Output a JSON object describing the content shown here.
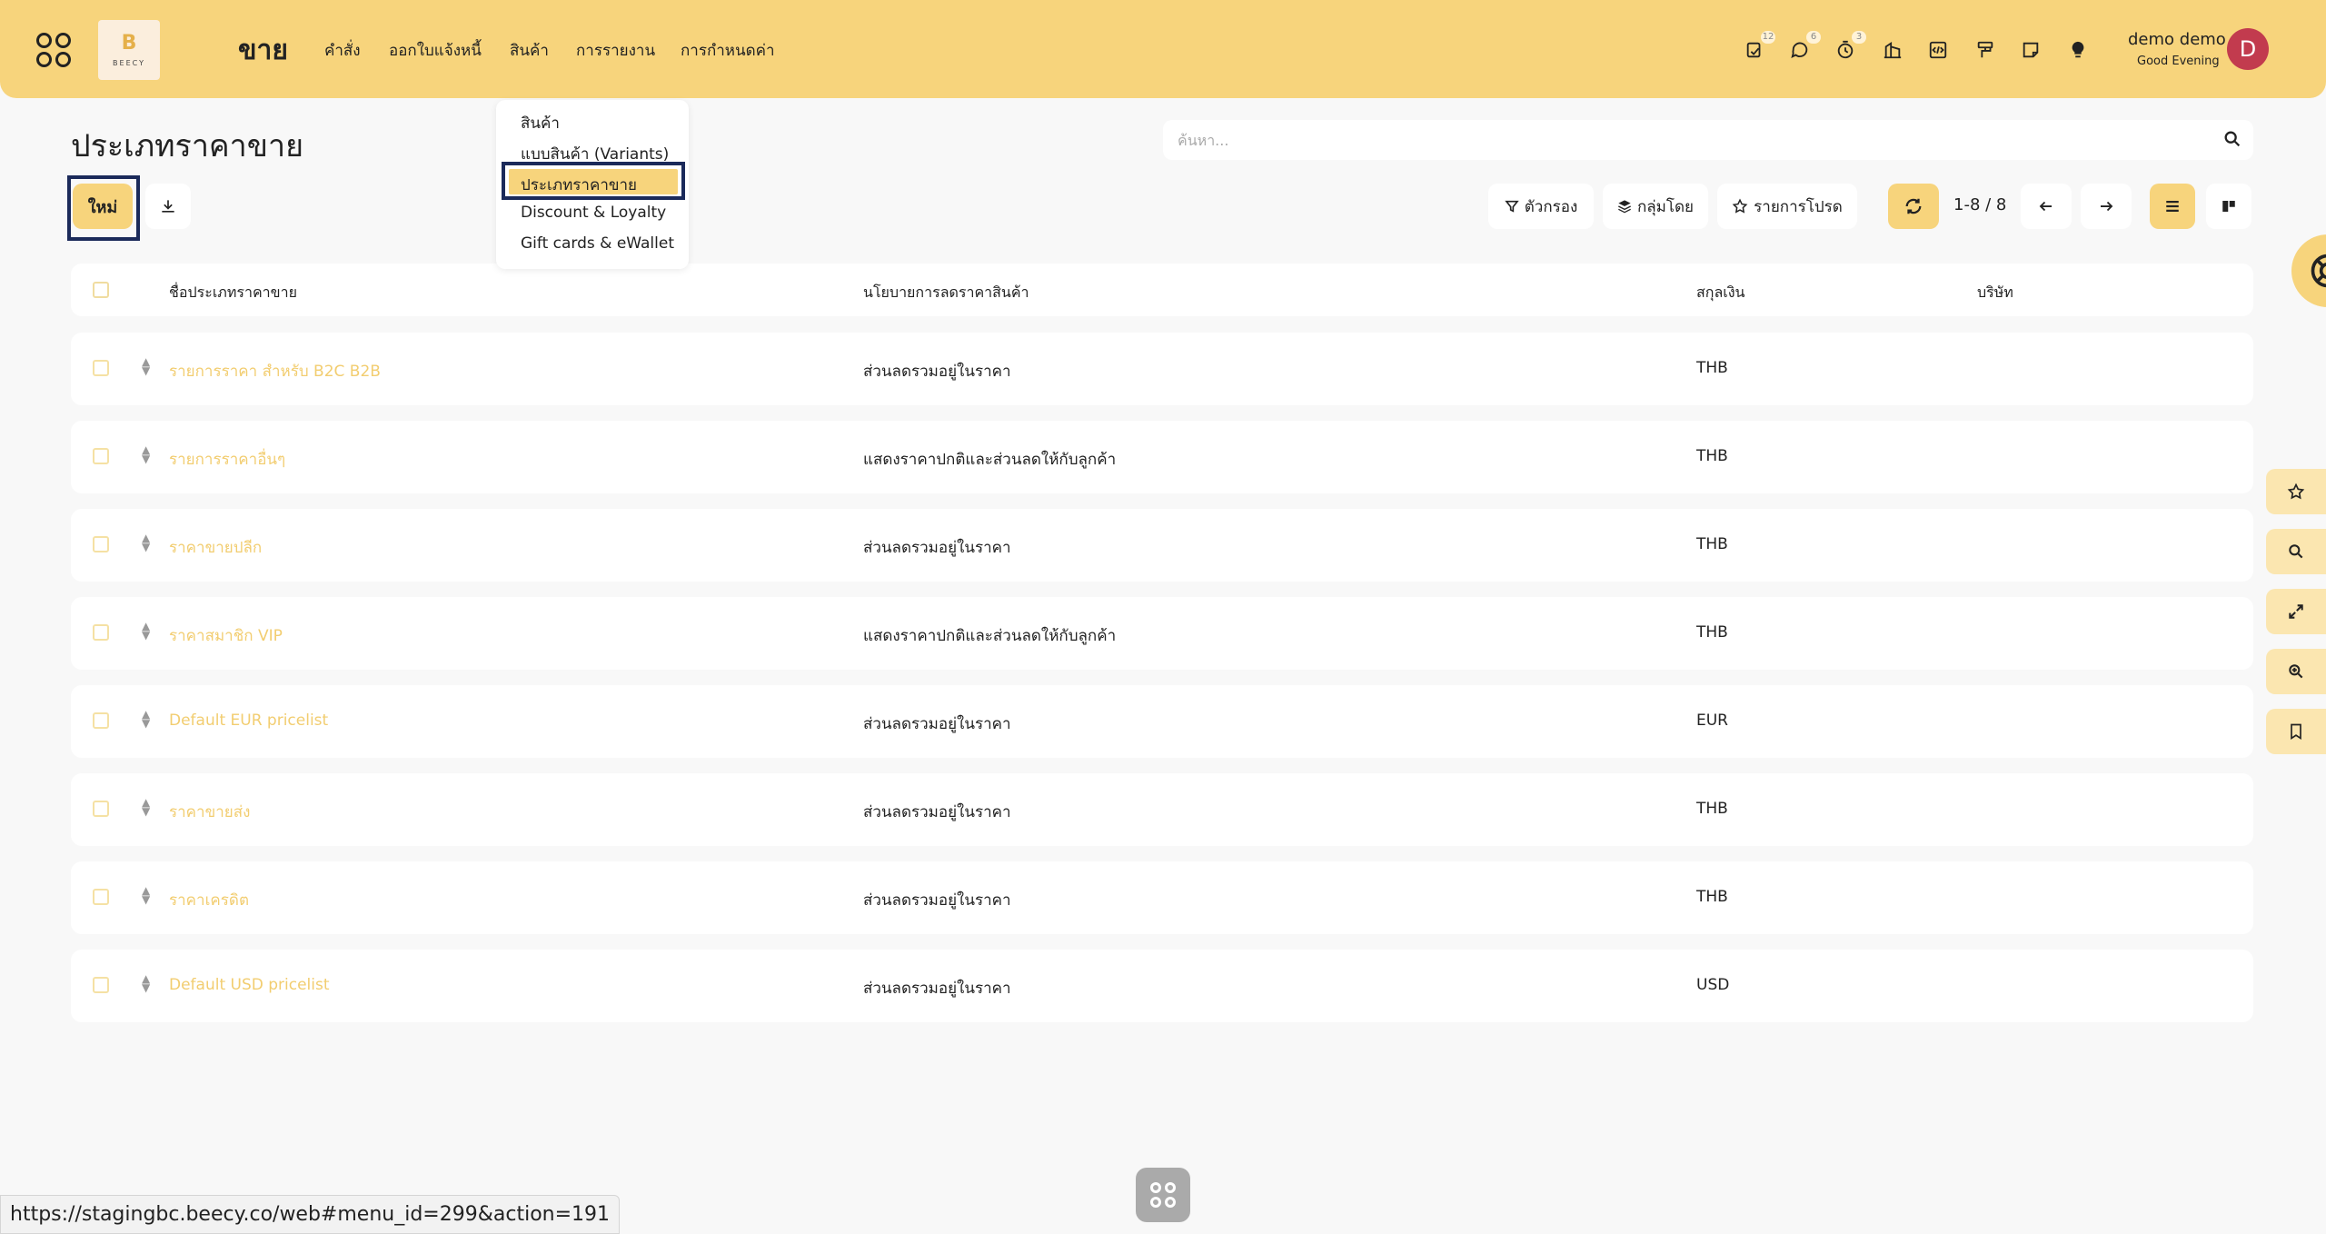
{
  "app": {
    "brand": "ขาย",
    "logo_letter": "B",
    "logo_text": "BEECY",
    "menu": [
      "คำสั่ง",
      "ออกใบแจ้งหนี้",
      "สินค้า",
      "การรายงาน",
      "การกำหนดค่า"
    ]
  },
  "systray": {
    "badges": [
      "12",
      "6",
      "3"
    ]
  },
  "user": {
    "name": "demo demo",
    "greeting": "Good Evening",
    "avatar_letter": "D",
    "avatar_color": "#c23b4e"
  },
  "page": {
    "title": "ประเภทราคาขาย"
  },
  "search": {
    "placeholder": "ค้นหา..."
  },
  "toolbar": {
    "new_label": "ใหม่",
    "filter_label": "ตัวกรอง",
    "group_label": "กลุ่มโดย",
    "favorites_label": "รายการโปรด",
    "pager": "1-8 / 8"
  },
  "dropdown": {
    "items": [
      "สินค้า",
      "แบบสินค้า (Variants)",
      "ประเภทราคาขาย",
      "Discount & Loyalty",
      "Gift cards & eWallet"
    ],
    "active_index": 2
  },
  "table": {
    "headers": {
      "name": "ชื่อประเภทราคาขาย",
      "policy": "นโยบายการลดราคาสินค้า",
      "currency": "สกุลเงิน",
      "company": "บริษัท"
    },
    "rows": [
      {
        "name": "รายการราคา สำหรับ B2C B2B",
        "policy": "ส่วนลดรวมอยู่ในราคา",
        "currency": "THB"
      },
      {
        "name": "รายการราคาอื่นๆ",
        "policy": "แสดงราคาปกติและส่วนลดให้กับลูกค้า",
        "currency": "THB"
      },
      {
        "name": "ราคาขายปลีก",
        "policy": "ส่วนลดรวมอยู่ในราคา",
        "currency": "THB"
      },
      {
        "name": "ราคาสมาชิก VIP",
        "policy": "แสดงราคาปกติและส่วนลดให้กับลูกค้า",
        "currency": "THB"
      },
      {
        "name": "Default EUR pricelist",
        "policy": "ส่วนลดรวมอยู่ในราคา",
        "currency": "EUR"
      },
      {
        "name": "ราคาขายส่ง",
        "policy": "ส่วนลดรวมอยู่ในราคา",
        "currency": "THB"
      },
      {
        "name": "ราคาเครดิต",
        "policy": "ส่วนลดรวมอยู่ในราคา",
        "currency": "THB"
      },
      {
        "name": "Default USD pricelist",
        "policy": "ส่วนลดรวมอยู่ในราคา",
        "currency": "USD"
      }
    ]
  },
  "statusbar": {
    "url": "https://stagingbc.beecy.co/web#menu_id=299&action=191"
  },
  "colors": {
    "accent": "#f7d47c",
    "link": "#f2cd70",
    "highlight_border": "#1b2a5a"
  }
}
